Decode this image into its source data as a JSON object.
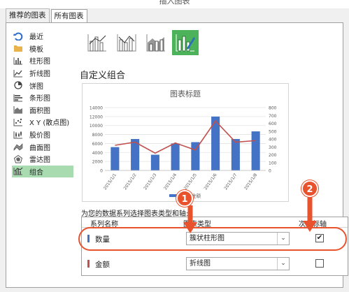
{
  "window": {
    "title": "插入图表"
  },
  "tabs": [
    {
      "label": "推荐的图表",
      "active": false
    },
    {
      "label": "所有图表",
      "active": true
    }
  ],
  "sidebar": {
    "items": [
      {
        "label": "最近",
        "icon": "recent-icon"
      },
      {
        "label": "模板",
        "icon": "folder-icon"
      },
      {
        "label": "柱形图",
        "icon": "column-chart-icon"
      },
      {
        "label": "折线图",
        "icon": "line-chart-icon"
      },
      {
        "label": "饼图",
        "icon": "pie-chart-icon"
      },
      {
        "label": "条形图",
        "icon": "bar-chart-icon"
      },
      {
        "label": "面积图",
        "icon": "area-chart-icon"
      },
      {
        "label": "X Y (散点图)",
        "icon": "scatter-chart-icon"
      },
      {
        "label": "股价图",
        "icon": "stock-chart-icon"
      },
      {
        "label": "曲面图",
        "icon": "surface-chart-icon"
      },
      {
        "label": "雷达图",
        "icon": "radar-chart-icon"
      },
      {
        "label": "组合",
        "icon": "combo-chart-icon",
        "selected": true
      }
    ]
  },
  "combo_types": [
    {
      "icon": "clustered-column-line-icon"
    },
    {
      "icon": "clustered-column-line-secondary-axis-icon"
    },
    {
      "icon": "stacked-area-clustered-column-icon"
    },
    {
      "icon": "custom-combination-icon",
      "selected": true
    }
  ],
  "section_title": "自定义组合",
  "chart_data": {
    "type": "bar",
    "title": "图表标题",
    "categories": [
      "2015/1/1",
      "2015/1/2",
      "2015/1/3",
      "2015/1/4",
      "2015/1/5",
      "2015/1/6",
      "2015/1/7",
      "2015/1/8"
    ],
    "series": [
      {
        "name": "数量",
        "type": "bar",
        "axis": "primary",
        "values": [
          5200,
          7000,
          3500,
          6000,
          6300,
          12000,
          7000,
          8700
        ]
      },
      {
        "name": "金额",
        "type": "line",
        "axis": "secondary",
        "values": [
          320,
          360,
          220,
          350,
          260,
          630,
          360,
          380
        ]
      }
    ],
    "y_ticks": [
      "0",
      "2000",
      "4000",
      "6000",
      "8000",
      "10000",
      "12000",
      "14000"
    ],
    "y2_ticks": [
      "0",
      "100",
      "200",
      "300",
      "400",
      "500",
      "600",
      "700",
      "800"
    ],
    "ylim": [
      0,
      14000
    ],
    "y2lim": [
      0,
      800
    ],
    "legend_label": "金额",
    "colors": {
      "bar": "#4472c4",
      "line": "#c0504d"
    }
  },
  "series_section": {
    "label": "为您的数据系列选择图表类型和轴:",
    "headers": {
      "name": "系列名称",
      "type": "图表类型",
      "axis": "次坐标轴"
    },
    "rows": [
      {
        "name": "数量",
        "color": "#4472c4",
        "chart_type": "簇状柱形图",
        "secondary": "✔"
      },
      {
        "name": "金额",
        "color": "#c0504d",
        "chart_type": "折线图",
        "secondary": ""
      }
    ]
  },
  "annotations": {
    "badge1": "1",
    "badge2": "2",
    "color": "#e8522d"
  }
}
